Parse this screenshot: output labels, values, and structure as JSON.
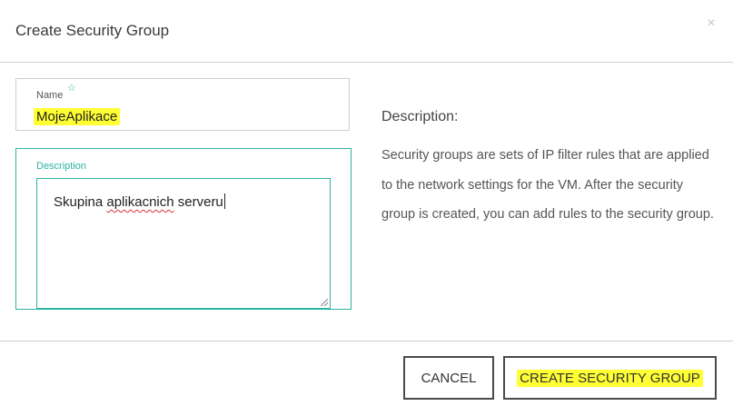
{
  "dialog": {
    "title": "Create Security Group",
    "close_icon": "close-icon",
    "close_glyph": "×"
  },
  "form": {
    "name_label": "Name",
    "required_icon": "star-icon",
    "required_glyph": "☆",
    "name_value": "MojeAplikace",
    "description_label": "Description",
    "description_value_part1": "Skupina ",
    "description_value_misspelled": "aplikacnich",
    "description_value_part2": " serveru"
  },
  "info": {
    "heading": "Description:",
    "body": "Security groups are sets of IP filter rules that are applied to the network settings for the VM. After the security group is created, you can add rules to the security group."
  },
  "buttons": {
    "cancel_label": "CANCEL",
    "create_label": "CREATE SECURITY GROUP"
  },
  "colors": {
    "accent": "#2bb3a3",
    "highlight": "#ffff33",
    "button_border": "#4a4a4a"
  }
}
